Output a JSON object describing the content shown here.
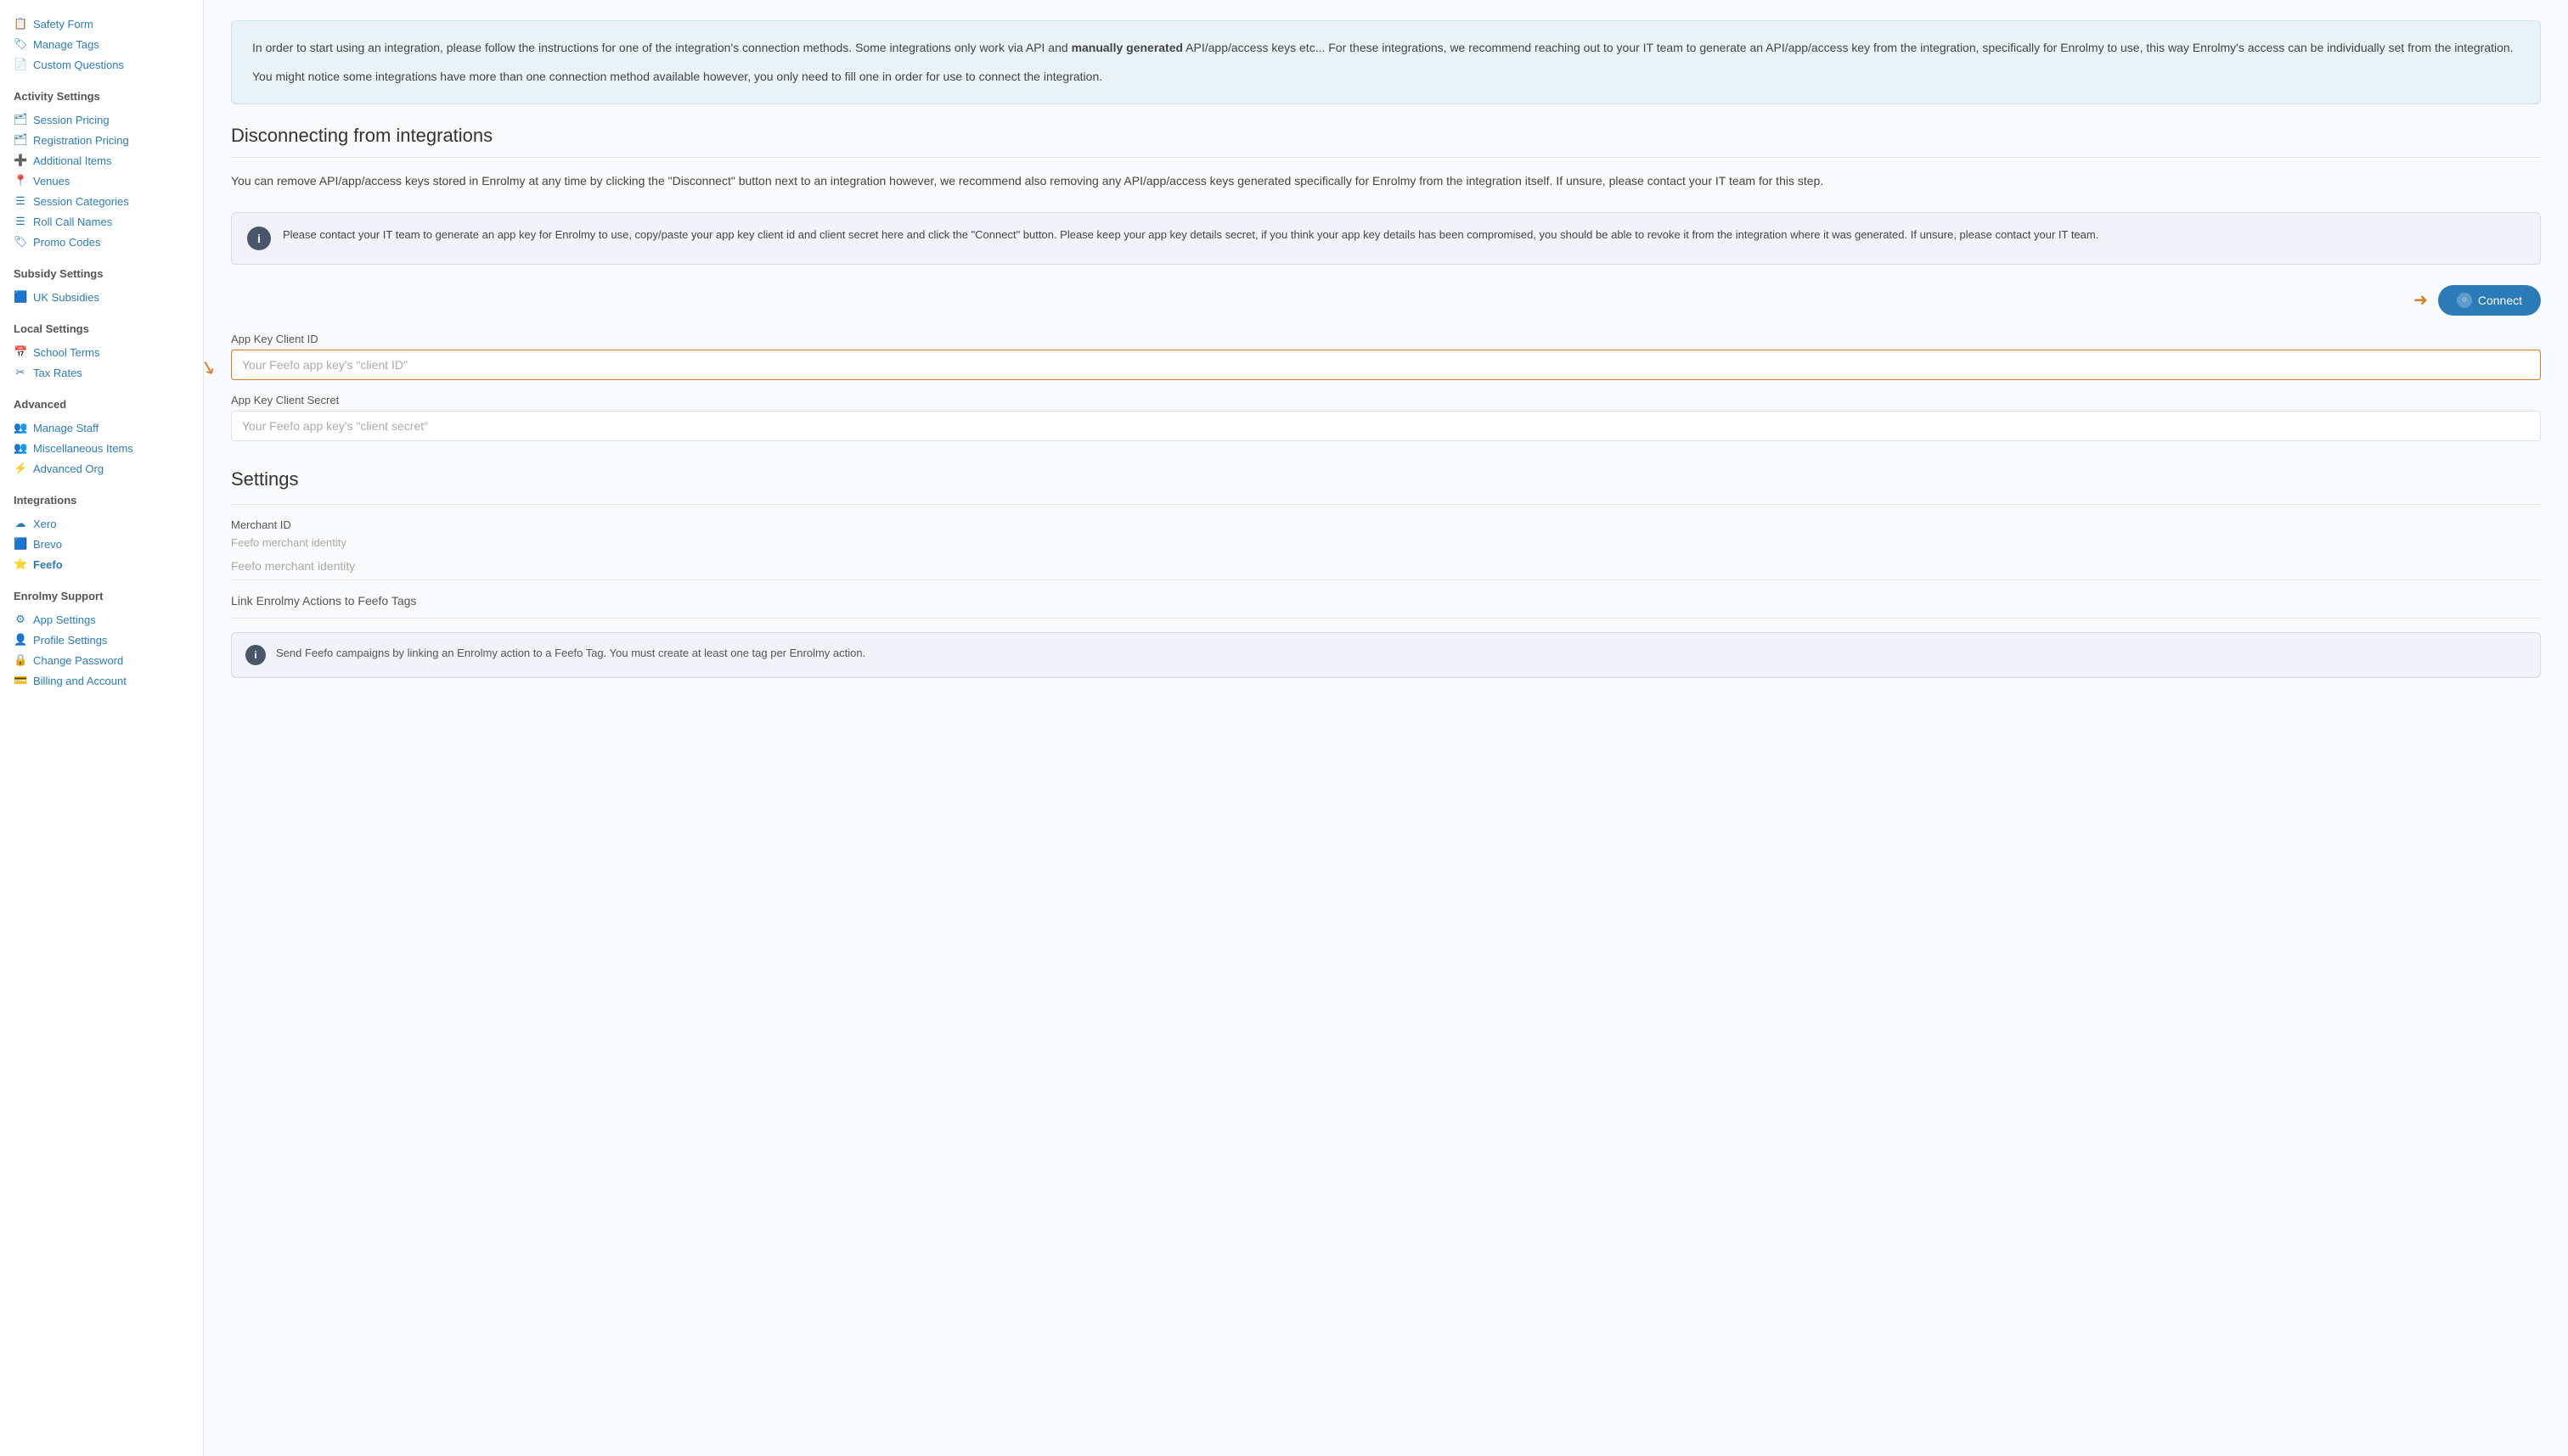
{
  "sidebar": {
    "sections": [
      {
        "title": "",
        "items": [
          {
            "id": "safety-form",
            "label": "Safety Form",
            "icon": "📋"
          },
          {
            "id": "manage-tags",
            "label": "Manage Tags",
            "icon": "🏷"
          },
          {
            "id": "custom-questions",
            "label": "Custom Questions",
            "icon": "📄"
          }
        ]
      },
      {
        "title": "Activity Settings",
        "items": [
          {
            "id": "session-pricing",
            "label": "Session Pricing",
            "icon": "🗂"
          },
          {
            "id": "registration-pricing",
            "label": "Registration Pricing",
            "icon": "🗂"
          },
          {
            "id": "additional-items",
            "label": "Additional Items",
            "icon": "➕"
          },
          {
            "id": "venues",
            "label": "Venues",
            "icon": "📍"
          },
          {
            "id": "session-categories",
            "label": "Session Categories",
            "icon": "☰"
          },
          {
            "id": "roll-call-names",
            "label": "Roll Call Names",
            "icon": "☰"
          },
          {
            "id": "promo-codes",
            "label": "Promo Codes",
            "icon": "🏷"
          }
        ]
      },
      {
        "title": "Subsidy Settings",
        "items": [
          {
            "id": "uk-subsidies",
            "label": "UK Subsidies",
            "icon": "🟦"
          }
        ]
      },
      {
        "title": "Local Settings",
        "items": [
          {
            "id": "school-terms",
            "label": "School Terms",
            "icon": "📅"
          },
          {
            "id": "tax-rates",
            "label": "Tax Rates",
            "icon": "✂"
          }
        ]
      },
      {
        "title": "Advanced",
        "items": [
          {
            "id": "manage-staff",
            "label": "Manage Staff",
            "icon": "👥"
          },
          {
            "id": "miscellaneous-items",
            "label": "Miscellaneous Items",
            "icon": "👥"
          },
          {
            "id": "advanced-org",
            "label": "Advanced Org",
            "icon": "⚡"
          }
        ]
      },
      {
        "title": "Integrations",
        "items": [
          {
            "id": "xero",
            "label": "Xero",
            "icon": "☁"
          },
          {
            "id": "brevo",
            "label": "Brevo",
            "icon": "🟦"
          },
          {
            "id": "feefo",
            "label": "Feefo",
            "icon": "⭐",
            "active": true
          }
        ]
      },
      {
        "title": "Enrolmy Support",
        "items": [
          {
            "id": "app-settings",
            "label": "App Settings",
            "icon": "⚙"
          },
          {
            "id": "profile-settings",
            "label": "Profile Settings",
            "icon": "👤"
          },
          {
            "id": "change-password",
            "label": "Change Password",
            "icon": "🔒"
          },
          {
            "id": "billing-and-account",
            "label": "Billing and Account",
            "icon": "💳"
          }
        ]
      }
    ]
  },
  "main": {
    "intro_block": {
      "para1": "In order to start using an integration, please follow the instructions for one of the integration's connection methods. Some integrations only work via API and manually generated API/app/access keys etc... For these integrations, we recommend reaching out to your IT team to generate an API/app/access key from the integration, specifically for Enrolmy to use, this way Enrolmy's access can be individually set from the integration.",
      "para1_bold": "manually generated",
      "para2": "You might notice some integrations have more than one connection method available however, you only need to fill one in order for use to connect the integration."
    },
    "disconnect_heading": "Disconnecting from integrations",
    "disconnect_para": "You can remove API/app/access keys stored in Enrolmy at any time by clicking the \"Disconnect\" button next to an integration however, we recommend also removing any API/app/access keys generated specifically for Enrolmy from the integration itself. If unsure, please contact your IT team for this step.",
    "info_banner": {
      "text": "Please contact your IT team to generate an app key for Enrolmy to use, copy/paste your app key client id and client secret here and click the \"Connect\" button. Please keep your app key details secret, if you think your app key details has been compromised, you should be able to revoke it from the integration where it was generated. If unsure, please contact your IT team."
    },
    "form": {
      "client_id_label": "App Key Client ID",
      "client_id_placeholder": "Your Feefo app key's \"client ID\"",
      "client_secret_label": "App Key Client Secret",
      "client_secret_placeholder": "Your Feefo app key's \"client secret\"",
      "connect_button": "Connect"
    },
    "settings": {
      "heading": "Settings",
      "merchant_id_label": "Merchant ID",
      "merchant_id_placeholder": "Feefo merchant identity",
      "merchant_id_value": "Feefo merchant identity",
      "link_section_label": "Link Enrolmy Actions to Feefo Tags",
      "link_info": "Send Feefo campaigns by linking an Enrolmy action to a Feefo Tag. You must create at least one tag per Enrolmy action."
    }
  }
}
